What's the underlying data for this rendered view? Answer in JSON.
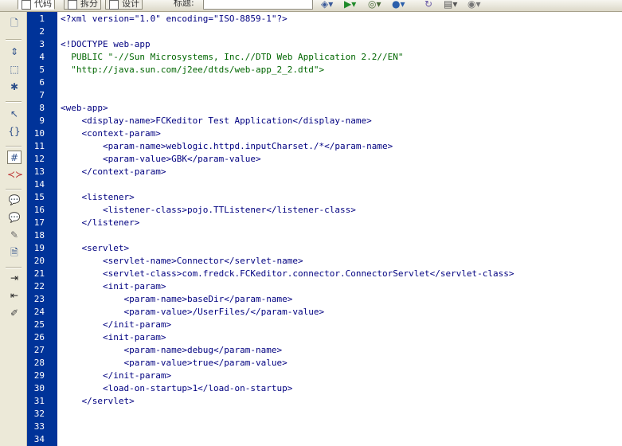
{
  "toolbar": {
    "tab_code": "代码",
    "tab_split": "拆分",
    "tab_design": "设计",
    "title_label": "标题:",
    "title_value": ""
  },
  "sidebar": {
    "icons": [
      "new-doc-icon",
      "expand-icon",
      "collapse-icon",
      "select-tag-icon",
      "wrap-icon",
      "braces-icon",
      "line-numbers-icon",
      "highlight-icon",
      "comment-icon",
      "remove-comment-icon",
      "wrap-tag-icon",
      "recent-snippet-icon",
      "indent-icon",
      "outdent-icon",
      "format-icon"
    ]
  },
  "code": {
    "lines": [
      {
        "n": "1",
        "t": "<?xml version=\"1.0\" encoding=\"ISO-8859-1\"?>"
      },
      {
        "n": "2",
        "t": ""
      },
      {
        "n": "3",
        "t": "<!DOCTYPE web-app"
      },
      {
        "n": "4",
        "t": "  PUBLIC \"-//Sun Microsystems, Inc.//DTD Web Application 2.2//EN\""
      },
      {
        "n": "5",
        "t": "  \"http://java.sun.com/j2ee/dtds/web-app_2_2.dtd\">"
      },
      {
        "n": "6",
        "t": ""
      },
      {
        "n": "7",
        "t": ""
      },
      {
        "n": "8",
        "t": "<web-app>"
      },
      {
        "n": "9",
        "t": "    <display-name>FCKeditor Test Application</display-name>"
      },
      {
        "n": "10",
        "t": "    <context-param>"
      },
      {
        "n": "11",
        "t": "        <param-name>weblogic.httpd.inputCharset./*</param-name>"
      },
      {
        "n": "12",
        "t": "        <param-value>GBK</param-value>"
      },
      {
        "n": "13",
        "t": "    </context-param>"
      },
      {
        "n": "14",
        "t": ""
      },
      {
        "n": "15",
        "t": "    <listener>"
      },
      {
        "n": "16",
        "t": "        <listener-class>pojo.TTListener</listener-class>"
      },
      {
        "n": "17",
        "t": "    </listener>"
      },
      {
        "n": "18",
        "t": ""
      },
      {
        "n": "19",
        "t": "    <servlet>"
      },
      {
        "n": "20",
        "t": "        <servlet-name>Connector</servlet-name>"
      },
      {
        "n": "21",
        "t": "        <servlet-class>com.fredck.FCKeditor.connector.ConnectorServlet</servlet-class>"
      },
      {
        "n": "22",
        "t": "        <init-param>"
      },
      {
        "n": "23",
        "t": "            <param-name>baseDir</param-name>"
      },
      {
        "n": "24",
        "t": "            <param-value>/UserFiles/</param-value>"
      },
      {
        "n": "25",
        "t": "        </init-param>"
      },
      {
        "n": "26",
        "t": "        <init-param>"
      },
      {
        "n": "27",
        "t": "            <param-name>debug</param-name>"
      },
      {
        "n": "28",
        "t": "            <param-value>true</param-value>"
      },
      {
        "n": "29",
        "t": "        </init-param>"
      },
      {
        "n": "30",
        "t": "        <load-on-startup>1</load-on-startup>"
      },
      {
        "n": "31",
        "t": "    </servlet>"
      },
      {
        "n": "32",
        "t": ""
      },
      {
        "n": "33",
        "t": ""
      },
      {
        "n": "34",
        "t": ""
      }
    ]
  }
}
